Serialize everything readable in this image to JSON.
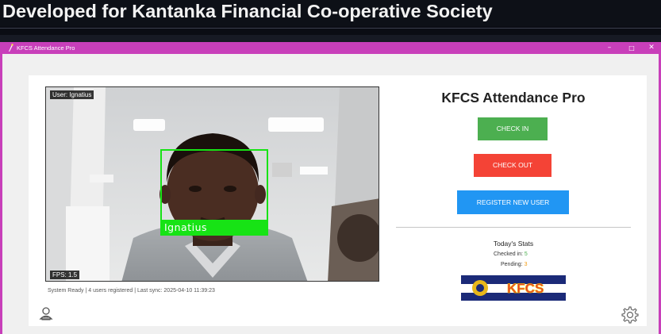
{
  "banner": {
    "title": "Developed for Kantanka Financial Co-operative Society"
  },
  "window": {
    "title": "KFCS Attendance Pro",
    "controls": {
      "minimize": "–",
      "maximize": "□",
      "close": "✕"
    }
  },
  "camera": {
    "user_label": "User: Ignatius",
    "fps_label": "FPS: 1.5",
    "detected_name": "Ignatius"
  },
  "status_bar": {
    "text": "System Ready | 4 users registered | Last sync: 2025-04-10 11:39:23"
  },
  "side": {
    "title": "KFCS Attendance Pro",
    "buttons": {
      "check_in": "CHECK IN",
      "check_out": "CHECK OUT",
      "register": "REGISTER NEW USER"
    },
    "stats": {
      "title": "Today's Stats",
      "checked_in_label": "Checked in:",
      "checked_in_value": "5",
      "pending_label": "Pending:",
      "pending_value": "3"
    },
    "logo_text": "KFCS"
  },
  "colors": {
    "window_border": "#c83fba",
    "check_in": "#4caf50",
    "check_out": "#f44336",
    "register": "#2196f3",
    "face_box": "#17e315"
  },
  "icons": [
    "app-icon",
    "user-icon",
    "gear-icon"
  ]
}
